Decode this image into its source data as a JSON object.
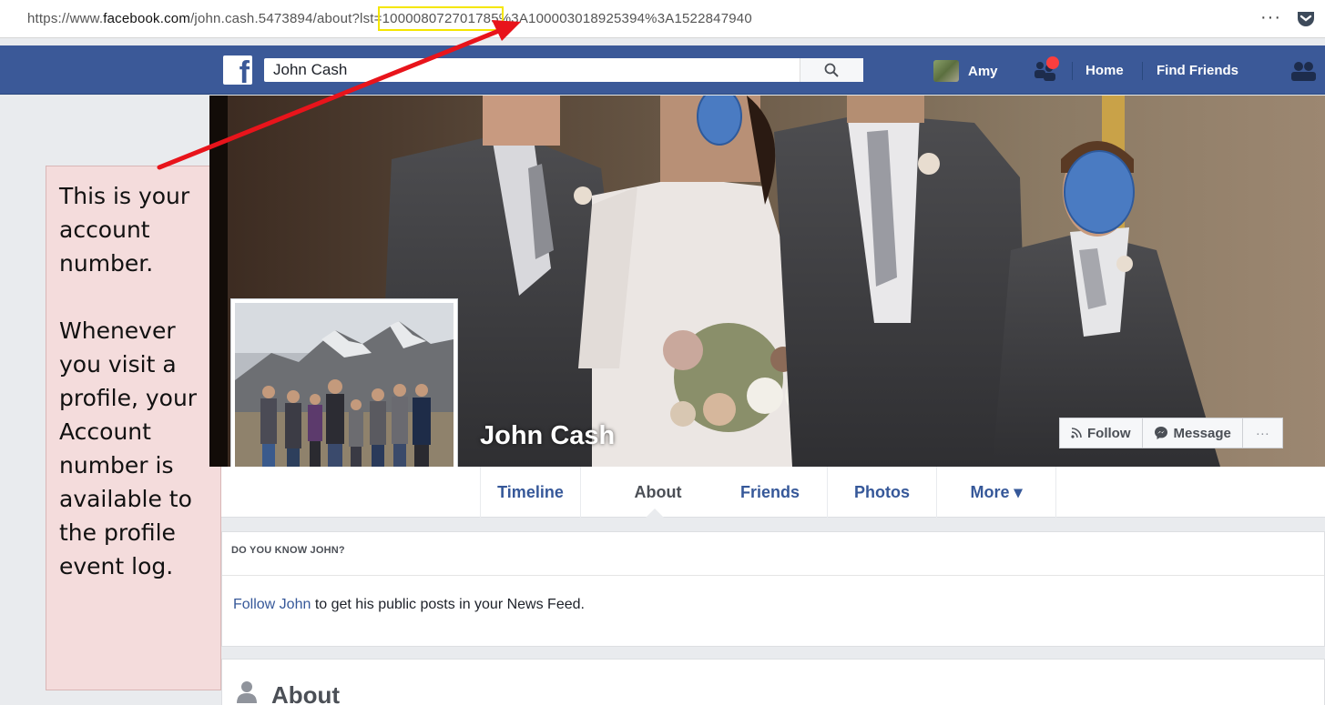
{
  "browser": {
    "url_prefix": "https://www.",
    "url_domain": "facebook.com",
    "url_path": "/john.cash.5473894/about?lst=",
    "url_highlight": "100008072701785",
    "url_suffix": "%3A100003018925394%3A1522847940",
    "menu_label": "···"
  },
  "header": {
    "search_value": "John Cash",
    "user_name": "Amy",
    "home_label": "Home",
    "find_friends_label": "Find Friends"
  },
  "profile": {
    "name": "John Cash",
    "follow_label": "Follow",
    "message_label": "Message",
    "more_actions_label": "···"
  },
  "tabs": [
    {
      "label": "Timeline"
    },
    {
      "label": "About"
    },
    {
      "label": "Friends"
    },
    {
      "label": "Photos"
    },
    {
      "label": "More ▾"
    }
  ],
  "know": {
    "heading": "DO YOU KNOW JOHN?",
    "link": "Follow John",
    "rest": " to get his public posts in your News Feed."
  },
  "about": {
    "title": "About"
  },
  "annotation": {
    "text": "This is your account number.\n\nWhenever you visit a profile, your Account number is available to the profile event log."
  },
  "colors": {
    "fb_blue": "#3b5998",
    "link": "#365899",
    "arrow": "#e8141b",
    "highlight": "#f5e600",
    "callout_bg": "#f4dcdc"
  }
}
